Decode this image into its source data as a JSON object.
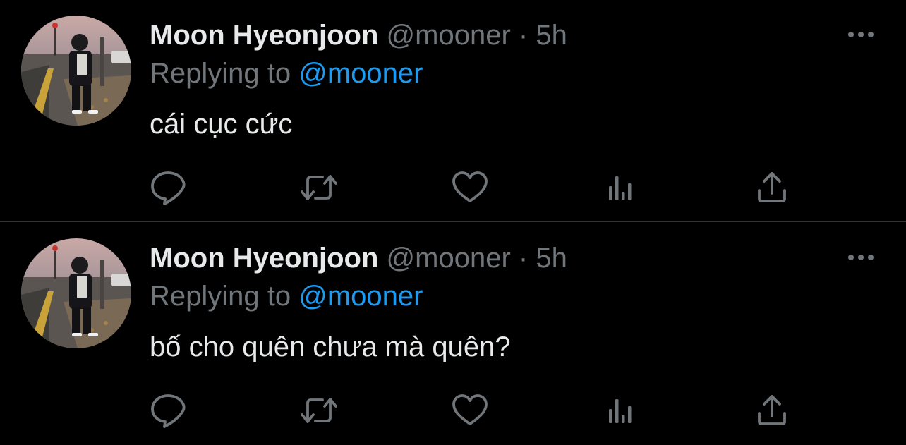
{
  "colors": {
    "background": "#000000",
    "text_primary": "#e7e9ea",
    "text_secondary": "#71767b",
    "accent": "#1d9bf0",
    "divider": "#2f3336"
  },
  "tweets": [
    {
      "author_name": "Moon Hyeonjoon",
      "author_handle": "@mooner",
      "separator": "·",
      "time": "5h",
      "replying_prefix": "Replying to",
      "replying_to": "@mooner",
      "text": "cái cục cức",
      "icons": [
        "avatar-photo",
        "more-icon",
        "reply-icon",
        "retweet-icon",
        "like-icon",
        "stats-icon",
        "share-icon"
      ]
    },
    {
      "author_name": "Moon Hyeonjoon",
      "author_handle": "@mooner",
      "separator": "·",
      "time": "5h",
      "replying_prefix": "Replying to",
      "replying_to": "@mooner",
      "text": "bố cho quên chưa mà quên?",
      "icons": [
        "avatar-photo",
        "more-icon",
        "reply-icon",
        "retweet-icon",
        "like-icon",
        "stats-icon",
        "share-icon"
      ]
    }
  ]
}
